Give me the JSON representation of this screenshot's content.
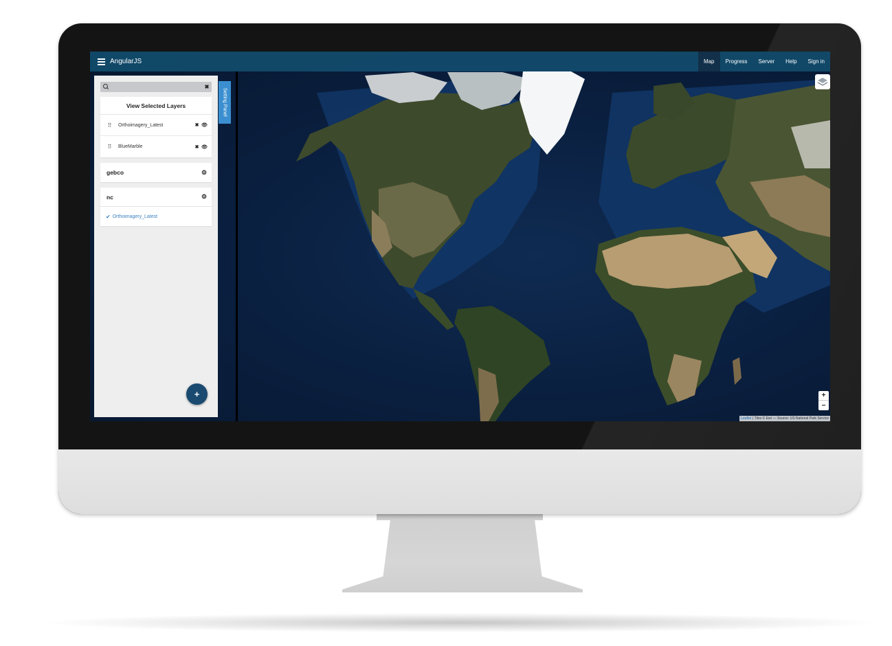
{
  "navbar": {
    "brand": "AngularJS",
    "items": [
      {
        "label": "Map",
        "active": true
      },
      {
        "label": "Progress",
        "active": false
      },
      {
        "label": "Server",
        "active": false
      },
      {
        "label": "Help",
        "active": false
      },
      {
        "label": "Sign in",
        "active": false
      }
    ]
  },
  "sidebar": {
    "search": {
      "value": "",
      "placeholder": ""
    },
    "selected_layers": {
      "title": "View Selected Layers",
      "layers": [
        {
          "name": "Orthoimagery_Latest"
        },
        {
          "name": "BlueMarble"
        }
      ]
    },
    "groups": [
      {
        "title": "gebco",
        "items": []
      },
      {
        "title": "nc",
        "items": [
          {
            "name": "Orthoimagery_Latest",
            "checked": true
          }
        ]
      }
    ],
    "add_button": "+"
  },
  "setting_tab": "Setting Panel",
  "map": {
    "zoom_in": "+",
    "zoom_out": "−",
    "attribution_link": "Leaflet",
    "attribution_text": "| Tiles © Esri — Source: US National Park Service"
  },
  "colors": {
    "navbar": "#124e70",
    "nav_active": "#12304a",
    "fab": "#1a4a70",
    "setting_tab": "#3b8fd0",
    "link": "#3a7fbf",
    "ocean": "#0a1f3f"
  }
}
